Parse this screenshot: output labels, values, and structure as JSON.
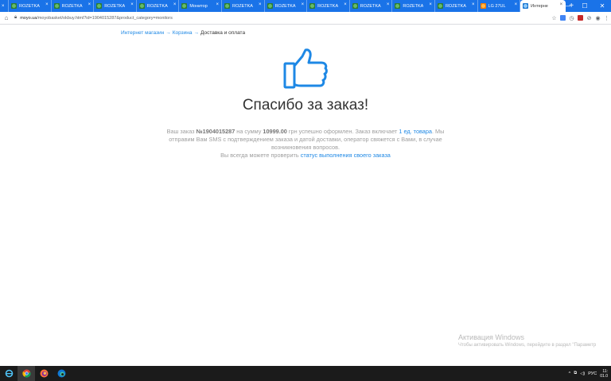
{
  "browser": {
    "tabs": [
      {
        "label": "ROZETKA",
        "favicon": "rozetka-icon",
        "active": false
      },
      {
        "label": "ROZETKA",
        "favicon": "rozetka-icon",
        "active": false
      },
      {
        "label": "ROZETKA",
        "favicon": "rozetka-icon",
        "active": false
      },
      {
        "label": "ROZETKA",
        "favicon": "rozetka-icon",
        "active": false
      },
      {
        "label": "Монитор",
        "favicon": "rozetka-icon",
        "active": false
      },
      {
        "label": "ROZETKA",
        "favicon": "rozetka-icon",
        "active": false
      },
      {
        "label": "ROZETKA",
        "favicon": "rozetka-icon",
        "active": false
      },
      {
        "label": "ROZETKA",
        "favicon": "rozetka-icon",
        "active": false
      },
      {
        "label": "ROZETKA",
        "favicon": "rozetka-icon",
        "active": false
      },
      {
        "label": "ROZETKA",
        "favicon": "rozetka-icon",
        "active": false
      },
      {
        "label": "ROZETKA",
        "favicon": "rozetka-icon",
        "active": false
      },
      {
        "label": "LG 27UL",
        "favicon": "hotline-icon",
        "active": false
      },
      {
        "label": "Интерне",
        "favicon": "moyo-icon",
        "active": true
      }
    ],
    "url_host": "moyo.ua",
    "url_path": "/moyobasket/okbuy.html?id=1904015287&product_category=monitors"
  },
  "breadcrumb": {
    "shop": "Интернет магазин",
    "cart": "Корзина",
    "current": "Доставка и оплата",
    "separator": "→"
  },
  "page": {
    "title": "Спасибо за заказ!",
    "msg_prefix": "Ваш заказ ",
    "order_number": "№1904015287",
    "msg_sum_prefix": " на сумму ",
    "amount": "10999.00",
    "msg_middle": " грн успешно оформлен. Заказ включает ",
    "items_link": "1 ед. товара",
    "msg_rest": ". Мы отправим Вам SMS с подтверждением заказа и датой доставки, оператор свяжется с Вами, в случае возникновения вопросов.",
    "check_prefix": "Вы всегда можете проверить ",
    "status_link": "статус выполнения своего заказа",
    "accent_color": "#1e88e5"
  },
  "watermark": {
    "title": "Активация Windows",
    "subtitle": "Чтобы активировать Windows, перейдите в раздел \"Параметр"
  },
  "taskbar": {
    "language": "РУС",
    "time": "11:",
    "date": "01.0"
  }
}
